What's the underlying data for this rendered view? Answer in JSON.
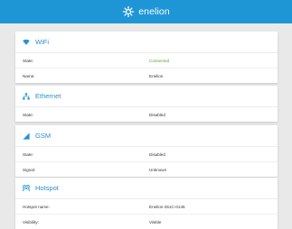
{
  "header": {
    "brand": "enelion",
    "accent": "#1e96d6",
    "logo_icon": "enelion-logo-icon"
  },
  "wifi": {
    "title": "WiFi",
    "icon": "wifi-icon",
    "rows": [
      {
        "label": "State:",
        "value": "Connected",
        "value_color": "#5aa02c"
      },
      {
        "label": "Name:",
        "value": "Enelion"
      }
    ]
  },
  "ethernet": {
    "title": "Ethernet",
    "icon": "ethernet-icon",
    "rows": [
      {
        "label": "State:",
        "value": "Disabled"
      }
    ]
  },
  "gsm": {
    "title": "GSM",
    "icon": "signal-icon",
    "rows": [
      {
        "label": "State:",
        "value": "Disabled"
      },
      {
        "label": "Signal:",
        "value": "Unknown"
      }
    ]
  },
  "hotspot": {
    "title": "Hotspot",
    "icon": "hotspot-icon",
    "rows": [
      {
        "label": "Hotspot name:",
        "value": "Enelion-251C-0145"
      },
      {
        "label": "Visibility:",
        "value": "Visible"
      }
    ]
  }
}
